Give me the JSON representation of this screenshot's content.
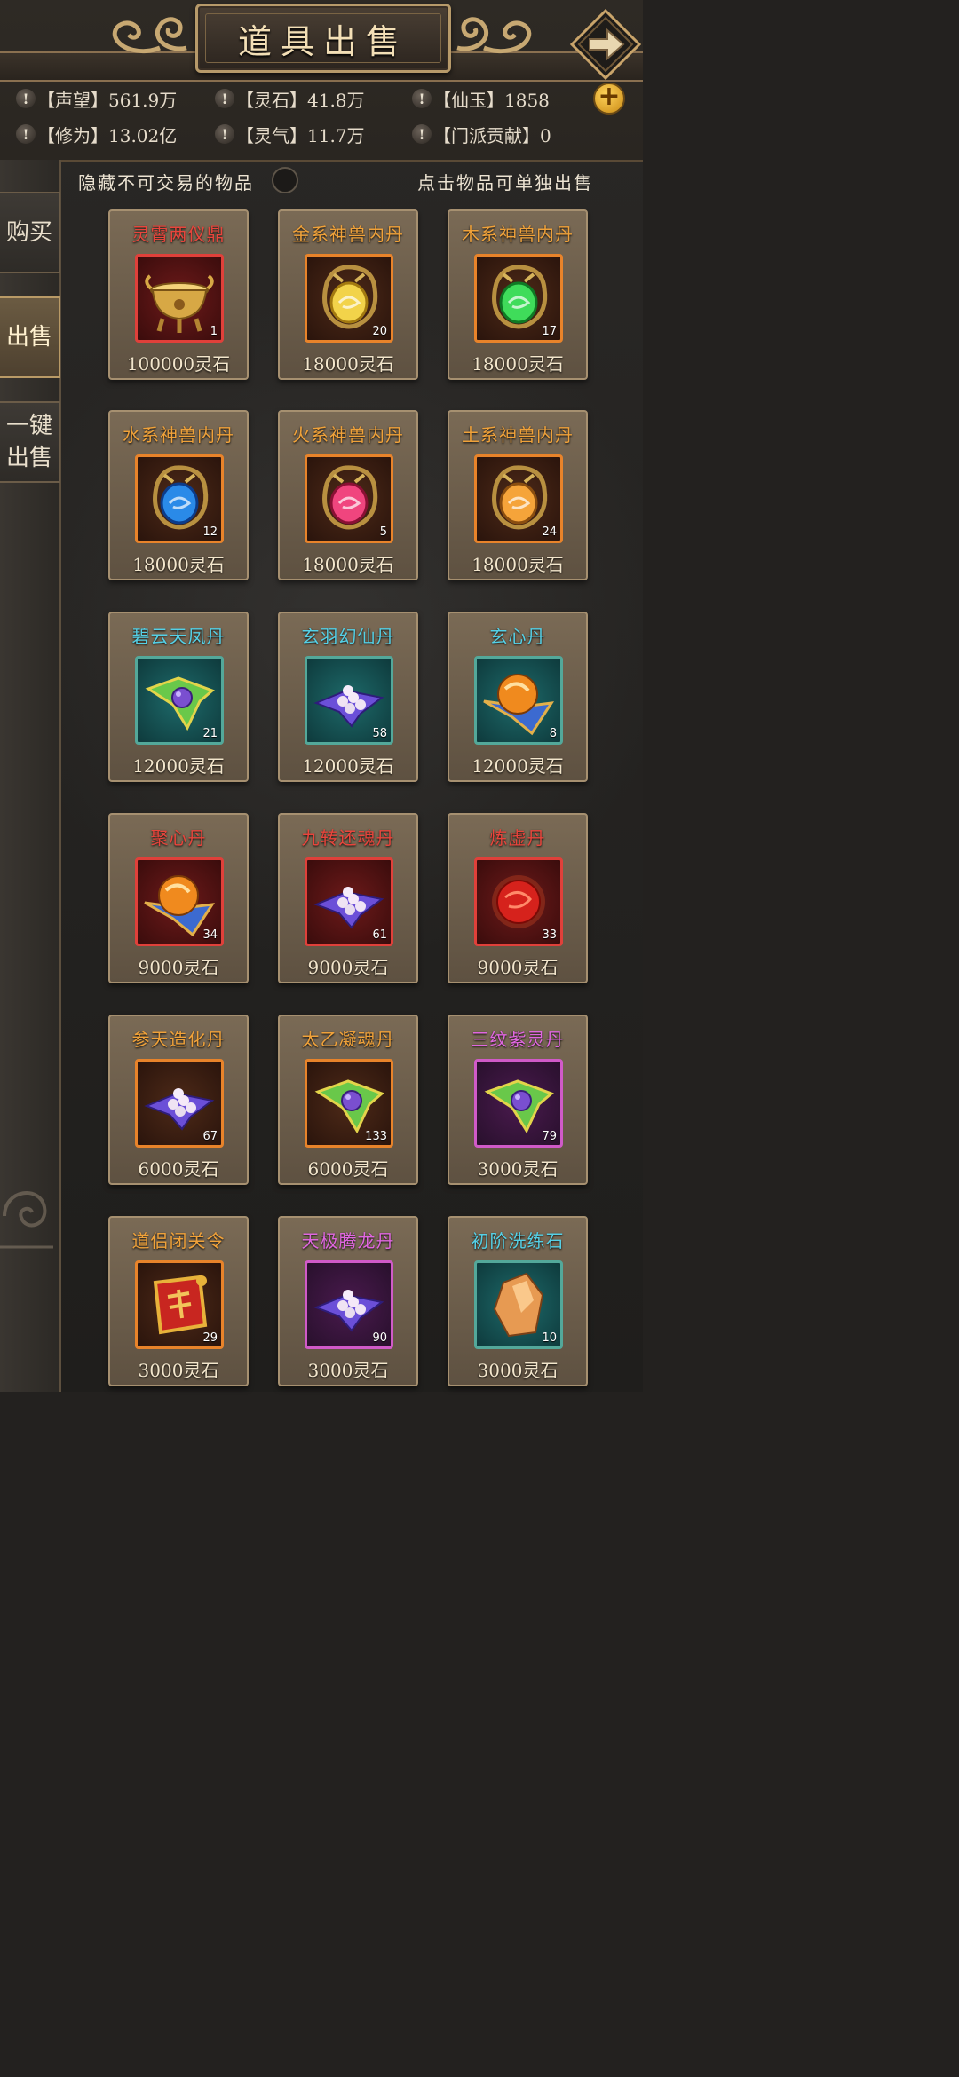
{
  "header": {
    "title": "道具出售"
  },
  "stats": [
    {
      "label": "【声望】561.9万"
    },
    {
      "label": "【灵石】41.8万"
    },
    {
      "label": "【仙玉】1858"
    },
    {
      "label": "【修为】13.02亿"
    },
    {
      "label": "【灵气】11.7万"
    },
    {
      "label": "【门派贡献】0"
    }
  ],
  "stats_bang": "!",
  "plus_label": "+",
  "tabs": [
    {
      "label": "购买",
      "active": false
    },
    {
      "label": "出售",
      "active": true
    },
    {
      "label": "一键出售",
      "active": false
    }
  ],
  "filter": {
    "hide_label": "隐藏不可交易的物品",
    "hint": "点击物品可单独出售"
  },
  "colors": {
    "red": "#e8453c",
    "orange": "#f0a23a",
    "cyan": "#55d0e6",
    "purple": "#e067e0"
  },
  "items": [
    {
      "name": "灵霄两仪鼎",
      "qty": "1",
      "price": "100000灵石",
      "tier": "red",
      "icon": "cauldron-icon"
    },
    {
      "name": "金系神兽内丹",
      "qty": "20",
      "price": "18000灵石",
      "tier": "orange",
      "icon": "gold-dragon-orb-icon"
    },
    {
      "name": "木系神兽内丹",
      "qty": "17",
      "price": "18000灵石",
      "tier": "orange",
      "icon": "green-dragon-orb-icon"
    },
    {
      "name": "水系神兽内丹",
      "qty": "12",
      "price": "18000灵石",
      "tier": "orange",
      "icon": "blue-dragon-orb-icon"
    },
    {
      "name": "火系神兽内丹",
      "qty": "5",
      "price": "18000灵石",
      "tier": "orange",
      "icon": "pink-dragon-orb-icon"
    },
    {
      "name": "土系神兽内丹",
      "qty": "24",
      "price": "18000灵石",
      "tier": "orange",
      "icon": "amber-dragon-orb-icon"
    },
    {
      "name": "碧云天凤丹",
      "qty": "21",
      "price": "12000灵石",
      "tier": "cyan",
      "icon": "green-cloth-pill-icon"
    },
    {
      "name": "玄羽幻仙丹",
      "qty": "58",
      "price": "12000灵石",
      "tier": "cyan",
      "icon": "pearl-cloth-icon"
    },
    {
      "name": "玄心丹",
      "qty": "8",
      "price": "12000灵石",
      "tier": "cyan",
      "icon": "orange-orb-cloth-icon"
    },
    {
      "name": "聚心丹",
      "qty": "34",
      "price": "9000灵石",
      "tier": "red",
      "icon": "orange-orb-cloth-icon"
    },
    {
      "name": "九转还魂丹",
      "qty": "61",
      "price": "9000灵石",
      "tier": "red",
      "icon": "pearl-cloth-icon"
    },
    {
      "name": "炼虚丹",
      "qty": "33",
      "price": "9000灵石",
      "tier": "red",
      "icon": "red-orb-icon"
    },
    {
      "name": "参天造化丹",
      "qty": "67",
      "price": "6000灵石",
      "tier": "orange",
      "icon": "pearl-cloth-icon"
    },
    {
      "name": "太乙凝魂丹",
      "qty": "133",
      "price": "6000灵石",
      "tier": "orange",
      "icon": "green-cloth-pill-icon"
    },
    {
      "name": "三纹紫灵丹",
      "qty": "79",
      "price": "3000灵石",
      "tier": "purple",
      "icon": "green-cloth-pill-icon"
    },
    {
      "name": "道侣闭关令",
      "qty": "29",
      "price": "3000灵石",
      "tier": "orange",
      "icon": "token-icon"
    },
    {
      "name": "天极腾龙丹",
      "qty": "90",
      "price": "3000灵石",
      "tier": "purple",
      "icon": "pearl-cloth-icon"
    },
    {
      "name": "初阶洗练石",
      "qty": "10",
      "price": "3000灵石",
      "tier": "cyan",
      "icon": "crystal-icon"
    }
  ]
}
